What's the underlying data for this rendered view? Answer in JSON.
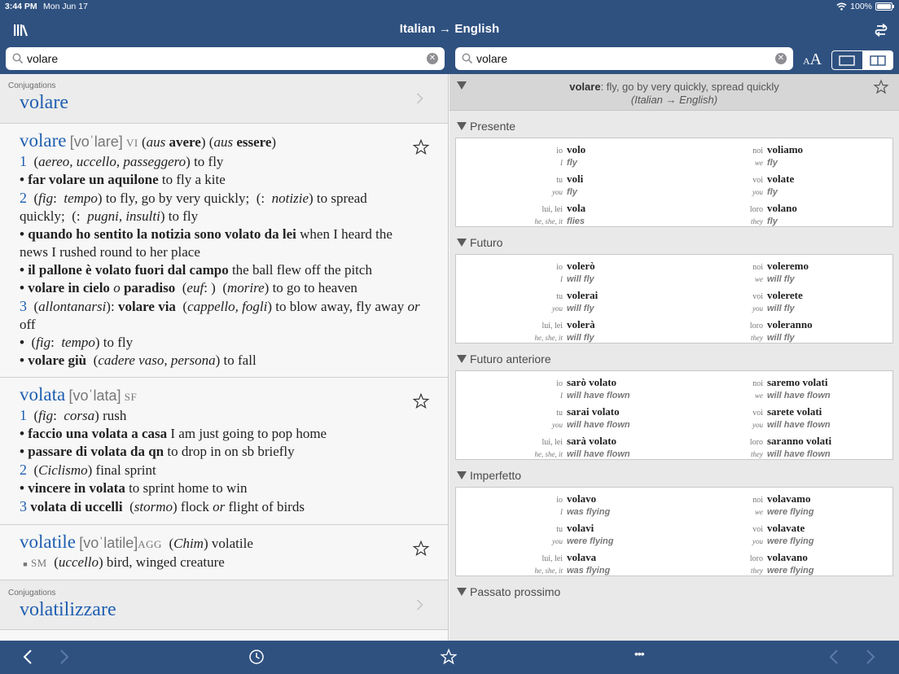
{
  "status": {
    "time": "3:44 PM",
    "date": "Mon Jun 17",
    "battery": "100%"
  },
  "header": {
    "title": "Italian → English",
    "left_icon": "library-icon",
    "right_icon": "swap-icon"
  },
  "search_left": {
    "value": "volare",
    "placeholder": ""
  },
  "search_right": {
    "value": "volare",
    "placeholder": ""
  },
  "fontsize": {
    "small": "A",
    "large": "A"
  },
  "left": {
    "conj1": {
      "label": "Conjugations",
      "word": "volare"
    },
    "entry_volare": {
      "head": "volare",
      "pron": "[voˈlare]",
      "pos": "VI",
      "l1_a": "(",
      "l1_aus1": "aus",
      "l1_b": " avere",
      "l1_c": ") (",
      "l1_aus2": "aus",
      "l1_d": " essere",
      "l1_e": ")",
      "s1": "1",
      "s1_ctx": "aereo, uccello, passeggero",
      "s1_tr": "to fly",
      "ex1_it": "far volare un aquilone",
      "ex1_en": "to fly a kite",
      "s2": "2",
      "s2_fig": "fig",
      "s2_tempo": "tempo",
      "s2_tr": "to fly, go by very quickly;",
      "s2_notizie": "notizie",
      "s2_tr2": "to spread",
      "s2_line2a": "quickly;",
      "s2_pugni": "pugni, insulti",
      "s2_tr3": "to fly",
      "ex2_it": "quando ho sentito la notizia sono volato da lei",
      "ex2_en": "when I heard the",
      "ex2_en2": "news I rushed round to her place",
      "ex3_it": "il pallone è volato fuori dal campo",
      "ex3_en": "the ball flew off the pitch",
      "ex4_it": "volare in cielo",
      "ex4_o": "o",
      "ex4_it2": "paradiso",
      "ex4_euf": "euf",
      "ex4_morire": "morire",
      "ex4_en": "to go to heaven",
      "s3": "3",
      "s3_ctx": "allontanarsi",
      "s3_it": "volare via",
      "s3_obj": "cappello, fogli",
      "s3_en": "to blow away, fly away",
      "s3_or": "or",
      "s3_off": "off",
      "ex5_fig": "fig",
      "ex5_tempo": "tempo",
      "ex5_en": "to fly",
      "ex6_it": "volare giù",
      "ex6_ctx": "cadere vaso, persona",
      "ex6_en": "to fall"
    },
    "entry_volata": {
      "head": "volata",
      "pron": "[voˈlata]",
      "pos": "SF",
      "s1": "1",
      "s1_fig": "fig",
      "s1_corsa": "corsa",
      "s1_en": "rush",
      "ex1_it": "faccio una volata a casa",
      "ex1_en": "I am just going to pop home",
      "ex2_it": "passare di volata da qn",
      "ex2_en": "to drop in on sb briefly",
      "s2": "2",
      "s2_ctx": "Ciclismo",
      "s2_en": "final sprint",
      "ex3_it": "vincere in volata",
      "ex3_en": "to sprint home to win",
      "s3": "3",
      "s3_it": "volata di uccelli",
      "s3_ctx": "stormo",
      "s3_en": "flock",
      "s3_or": "or",
      "s3_en2": "flight of birds"
    },
    "entry_volatile": {
      "head": "volatile",
      "pron": "[voˈlatile]",
      "pos": "AGG",
      "ctx": "Chim",
      "en": "volatile",
      "sub_pos": "SM",
      "sub_ctx": "uccello",
      "sub_en": "bird, winged creature"
    },
    "conj2": {
      "label": "Conjugations",
      "word": "volatilizzare"
    }
  },
  "right": {
    "head_word": "volare",
    "head_def": ": fly, go by very quickly, spread quickly",
    "head_lang": "(Italian → English)",
    "sections": [
      {
        "title": "Presente",
        "left": [
          [
            "io",
            "volo"
          ],
          [
            "I",
            "fly"
          ],
          [
            "tu",
            "voli"
          ],
          [
            "you",
            "fly"
          ],
          [
            "lui, lei",
            "vola"
          ],
          [
            "he, she, it",
            "flies"
          ]
        ],
        "right": [
          [
            "noi",
            "voliamo"
          ],
          [
            "we",
            "fly"
          ],
          [
            "voi",
            "volate"
          ],
          [
            "you",
            "fly"
          ],
          [
            "loro",
            "volano"
          ],
          [
            "they",
            "fly"
          ]
        ]
      },
      {
        "title": "Futuro",
        "left": [
          [
            "io",
            "volerò"
          ],
          [
            "I",
            "will fly"
          ],
          [
            "tu",
            "volerai"
          ],
          [
            "you",
            "will fly"
          ],
          [
            "lui, lei",
            "volerà"
          ],
          [
            "he, she, it",
            "will fly"
          ]
        ],
        "right": [
          [
            "noi",
            "voleremo"
          ],
          [
            "we",
            "will fly"
          ],
          [
            "voi",
            "volerete"
          ],
          [
            "you",
            "will fly"
          ],
          [
            "loro",
            "voleranno"
          ],
          [
            "they",
            "will fly"
          ]
        ]
      },
      {
        "title": "Futuro anteriore",
        "left": [
          [
            "io",
            "sarò volato"
          ],
          [
            "I",
            "will have flown"
          ],
          [
            "tu",
            "sarai volato"
          ],
          [
            "you",
            "will have flown"
          ],
          [
            "lui, lei",
            "sarà volato"
          ],
          [
            "he, she, it",
            "will have flown"
          ]
        ],
        "right": [
          [
            "noi",
            "saremo volati"
          ],
          [
            "we",
            "will have flown"
          ],
          [
            "voi",
            "sarete volati"
          ],
          [
            "you",
            "will have flown"
          ],
          [
            "loro",
            "saranno volati"
          ],
          [
            "they",
            "will have flown"
          ]
        ]
      },
      {
        "title": "Imperfetto",
        "left": [
          [
            "io",
            "volavo"
          ],
          [
            "I",
            "was flying"
          ],
          [
            "tu",
            "volavi"
          ],
          [
            "you",
            "were flying"
          ],
          [
            "lui, lei",
            "volava"
          ],
          [
            "he, she, it",
            "was flying"
          ]
        ],
        "right": [
          [
            "noi",
            "volavamo"
          ],
          [
            "we",
            "were flying"
          ],
          [
            "voi",
            "volavate"
          ],
          [
            "you",
            "were flying"
          ],
          [
            "loro",
            "volavano"
          ],
          [
            "they",
            "were flying"
          ]
        ]
      },
      {
        "title": "Passato prossimo",
        "left": [],
        "right": []
      }
    ]
  },
  "toolbar": {
    "more_label": "•••"
  }
}
